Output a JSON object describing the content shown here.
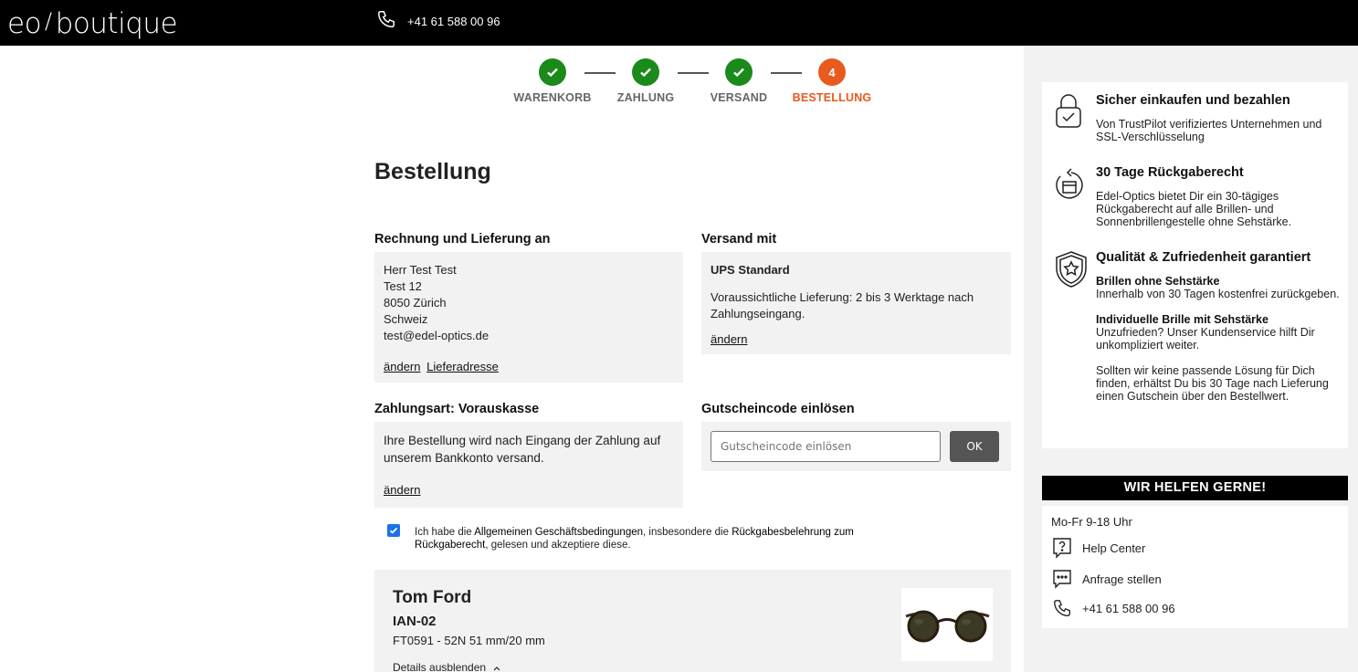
{
  "header": {
    "logo_text_a": "eo",
    "logo_slash": "/",
    "logo_text_b": "boutique",
    "phone": "+41 61 588 00 96"
  },
  "steps": [
    {
      "label": "WARENKORB",
      "state": "done",
      "number": ""
    },
    {
      "label": "ZAHLUNG",
      "state": "done",
      "number": ""
    },
    {
      "label": "VERSAND",
      "state": "done",
      "number": ""
    },
    {
      "label": "BESTELLUNG",
      "state": "active",
      "number": "4"
    }
  ],
  "page": {
    "title": "Bestellung"
  },
  "billing": {
    "title": "Rechnung und Lieferung an",
    "lines": [
      "Herr Test Test",
      "Test 12",
      "8050 Zürich",
      "Schweiz",
      "test@edel-optics.de"
    ],
    "change_link": "ändern",
    "address_link": "Lieferadresse"
  },
  "shipping": {
    "title": "Versand mit",
    "method": "UPS Standard",
    "eta": "Voraussichtliche Lieferung: 2 bis 3 Werktage nach Zahlungseingang.",
    "change_link": "ändern"
  },
  "payment": {
    "title": "Zahlungsart: Vorauskasse",
    "text": "Ihre Bestellung wird nach Eingang der Zahlung auf unserem Bankkonto versand.",
    "change_link": "ändern"
  },
  "voucher": {
    "title": "Gutscheincode einlösen",
    "placeholder": "Gutscheincode einlösen",
    "button": "OK"
  },
  "terms": {
    "checked": true,
    "pre": "Ich habe die ",
    "agb": "Allgemeinen Geschäftsbedingungen",
    "mid": ", insbesondere die ",
    "rueck": "Rückgabesbelehrung zum Rückgaberecht",
    "post": ", gelesen und akzeptiere diese."
  },
  "product": {
    "brand": "Tom Ford",
    "model": "IAN-02",
    "variant": "FT0591 - 52N 51 mm/20 mm",
    "details_toggle": "Details ausblenden"
  },
  "trust": {
    "secure_title": "Sicher einkaufen und bezahlen",
    "secure_text": "Von TrustPilot verifiziertes Unternehmen und SSL-Verschlüsselung",
    "return_title": "30 Tage Rückgaberecht",
    "return_text": "Edel-Optics bietet Dir ein 30-tägiges Rückgaberecht auf alle Brillen- und Sonnenbrillengestelle ohne Sehstärke.",
    "quality_title": "Qualität & Zufriedenheit garantiert",
    "q1_title": "Brillen ohne Sehstärke",
    "q1_text": "Innerhalb von 30 Tagen kostenfrei zurückgeben.",
    "q2_title": "Individuelle Brille mit Sehstärke",
    "q2_text": "Unzufrieden? Unser Kundenservice hilft Dir unkompliziert weiter.",
    "q3_text": "Sollten wir keine passende Lösung für Dich finden, erhältst Du bis 30 Tage nach Lieferung einen Gutschein über den Bestellwert."
  },
  "help": {
    "header": "WIR HELFEN GERNE!",
    "hours": "Mo-Fr 9-18 Uhr",
    "help_center": "Help Center",
    "request": "Anfrage stellen",
    "phone": "+41 61 588 00 96"
  },
  "colors": {
    "done": "#1a8a1a",
    "active": "#e85a1e",
    "panel": "#f2f2f2"
  }
}
